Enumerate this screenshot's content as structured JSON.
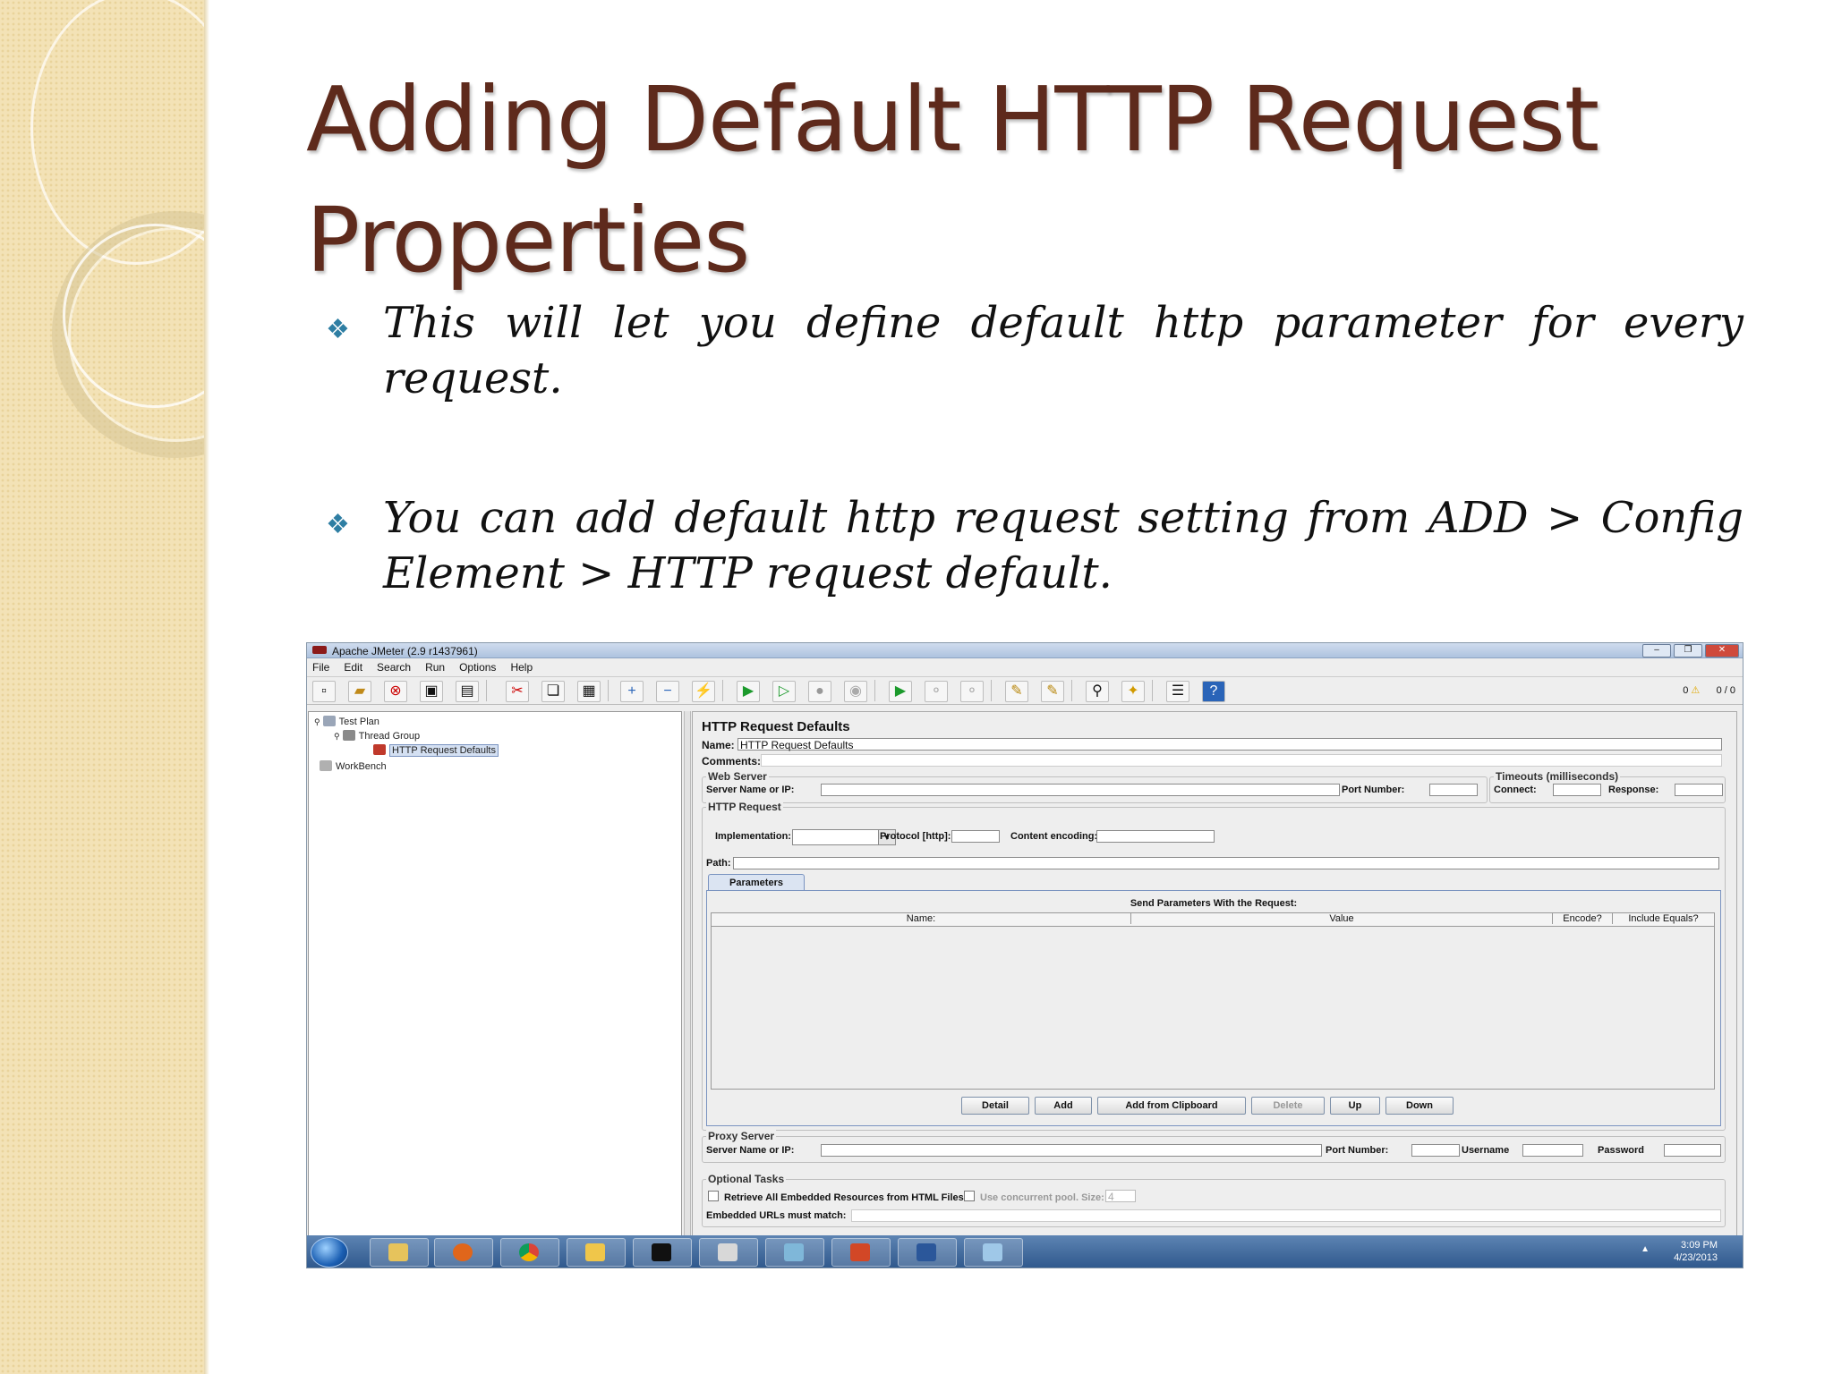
{
  "slide": {
    "title": "Adding Default HTTP Request Properties",
    "bullets": [
      "This will let you define default http parameter for every request.",
      "You can add default http request setting from ADD > Config Element  > HTTP request default."
    ]
  },
  "app": {
    "window_title": "Apache JMeter (2.9 r1437961)",
    "menu": [
      "File",
      "Edit",
      "Search",
      "Run",
      "Options",
      "Help"
    ],
    "warning_count": "0",
    "thread_count": "0 / 0",
    "tree": {
      "test_plan": "Test Plan",
      "thread_group": "Thread Group",
      "http_defaults": "HTTP Request Defaults",
      "workbench": "WorkBench"
    },
    "panel": {
      "heading": "HTTP Request Defaults",
      "name_label": "Name:",
      "name_value": "HTTP Request Defaults",
      "comments_label": "Comments:",
      "web_server": {
        "legend": "Web Server",
        "server_label": "Server Name or IP:",
        "port_label": "Port Number:"
      },
      "timeouts": {
        "legend": "Timeouts (milliseconds)",
        "connect_label": "Connect:",
        "response_label": "Response:"
      },
      "http_request": {
        "legend": "HTTP Request",
        "implementation_label": "Implementation:",
        "protocol_label": "Protocol [http]:",
        "encoding_label": "Content encoding:",
        "path_label": "Path:"
      },
      "parameters": {
        "tab": "Parameters",
        "caption": "Send Parameters With the Request:",
        "columns": [
          "Name:",
          "Value",
          "Encode?",
          "Include Equals?"
        ],
        "buttons": {
          "detail": "Detail",
          "add": "Add",
          "add_clipboard": "Add from Clipboard",
          "delete": "Delete",
          "up": "Up",
          "down": "Down"
        }
      },
      "proxy": {
        "legend": "Proxy Server",
        "server_label": "Server Name or IP:",
        "port_label": "Port Number:",
        "username_label": "Username",
        "password_label": "Password"
      },
      "optional": {
        "legend": "Optional Tasks",
        "retrieve_label": "Retrieve All Embedded Resources from HTML Files",
        "concurrent_label": "Use concurrent pool. Size:",
        "concurrent_size": "4",
        "embedded_label": "Embedded URLs must match:"
      }
    },
    "taskbar": {
      "time": "3:09 PM",
      "date": "4/23/2013"
    }
  },
  "colors": {
    "title": "#5e2a1c",
    "bullet_marker": "#2e7ea3",
    "band": "#f3e2b6"
  }
}
